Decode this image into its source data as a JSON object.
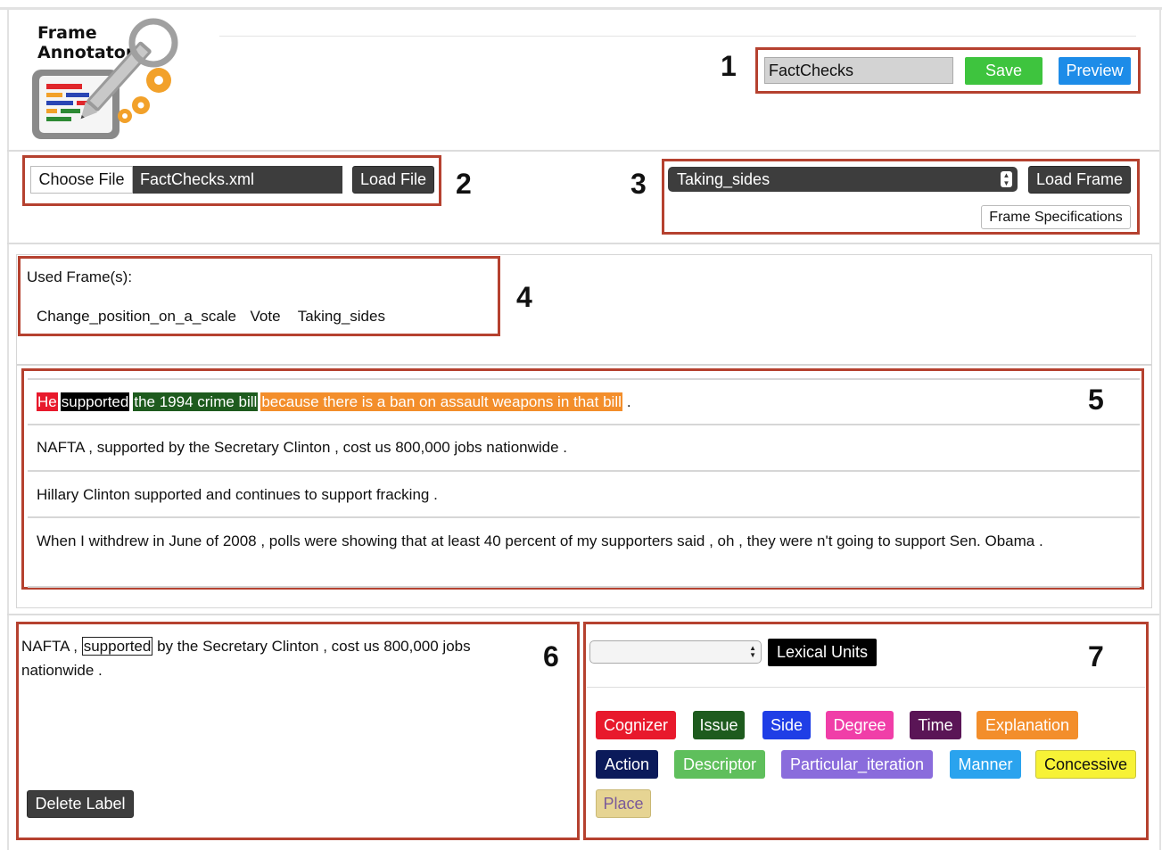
{
  "app": {
    "logo_line1": "Frame",
    "logo_line2": "Annotator"
  },
  "annotations": {
    "n1": "1",
    "n2": "2",
    "n3": "3",
    "n4": "4",
    "n5": "5",
    "n6": "6",
    "n7": "7"
  },
  "toolbar": {
    "filename_value": "FactChecks",
    "save_label": "Save",
    "preview_label": "Preview"
  },
  "file_loader": {
    "choose_label": "Choose File",
    "chosen_file": "FactChecks.xml",
    "load_label": "Load File"
  },
  "frame_loader": {
    "selected_frame": "Taking_sides",
    "load_label": "Load Frame",
    "specs_label": "Frame Specifications"
  },
  "used_frames": {
    "title": "Used Frame(s):",
    "frames": [
      "Change_position_on_a_scale",
      "Vote",
      "Taking_sides"
    ]
  },
  "sentences": {
    "s1": {
      "w1": "He",
      "w2": "supported",
      "w3": "the 1994 crime bill",
      "w4": "because there is a ban on assault weapons in that bill",
      "end": "."
    },
    "s2": "NAFTA , supported by the Secretary Clinton , cost us 800,000 jobs nationwide .",
    "s3": "Hillary Clinton supported and continues to support fracking .",
    "s4": "When I withdrew in June of 2008 , polls were showing that at least 40 percent of my supporters said , oh , they were n't going to support Sen. Obama ."
  },
  "editor": {
    "before": "NAFTA ,",
    "target": "supported",
    "after": "by the Secretary Clinton , cost us 800,000 jobs nationwide .",
    "delete_label": "Delete Label"
  },
  "labels_panel": {
    "lu_select_value": "",
    "lexical_units_label": "Lexical Units",
    "tags": [
      {
        "label": "Cognizer",
        "color": "#e8192c",
        "text": "#ffffff"
      },
      {
        "label": "Issue",
        "color": "#1e5b1e",
        "text": "#ffffff"
      },
      {
        "label": "Side",
        "color": "#1f3ee6",
        "text": "#ffffff"
      },
      {
        "label": "Degree",
        "color": "#f03ea8",
        "text": "#ffffff"
      },
      {
        "label": "Time",
        "color": "#5a1556",
        "text": "#ffffff"
      },
      {
        "label": "Explanation",
        "color": "#f38e2b",
        "text": "#ffffff"
      },
      {
        "label": "Action",
        "color": "#0b1a5a",
        "text": "#ffffff"
      },
      {
        "label": "Descriptor",
        "color": "#5fbf5c",
        "text": "#ffffff"
      },
      {
        "label": "Particular_iteration",
        "color": "#8a6cdc",
        "text": "#ffffff"
      },
      {
        "label": "Manner",
        "color": "#2aa3ee",
        "text": "#ffffff"
      },
      {
        "label": "Concessive",
        "color": "#f7f236",
        "text": "#111111"
      },
      {
        "label": "Place",
        "color": "#e6d493",
        "text": "#7a5a9a"
      }
    ]
  },
  "colors": {
    "annotation_box": "#b5412f",
    "save_green": "#3ec43e",
    "preview_blue": "#1d8ce8",
    "dark_button": "#3d3d3d"
  }
}
